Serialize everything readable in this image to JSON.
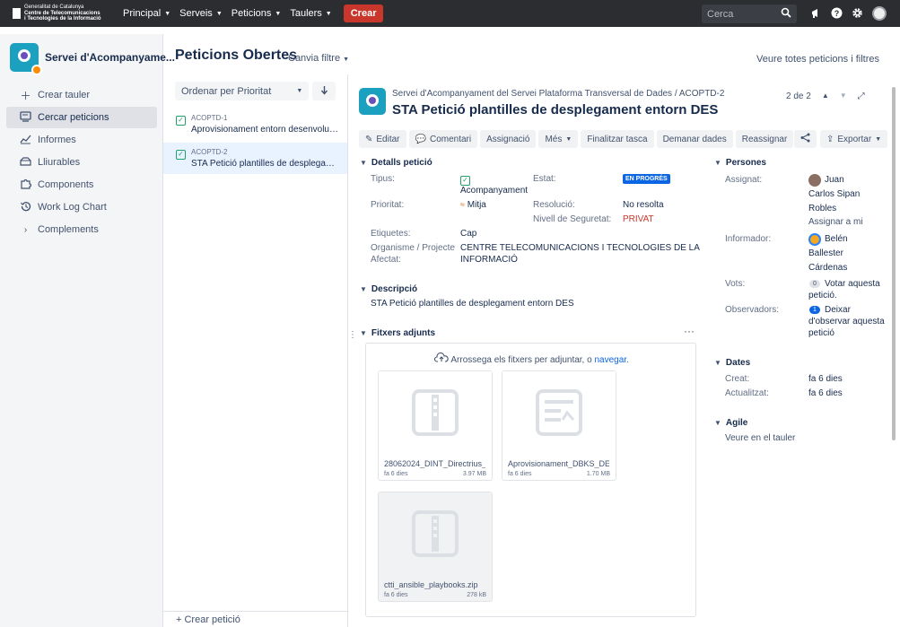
{
  "topbar": {
    "logo_lines": [
      "Generalitat de Catalunya",
      "Centre de Telecomunicacions",
      "i Tecnologies de la Informació"
    ],
    "nav": [
      "Principal",
      "Serveis",
      "Peticions",
      "Taulers"
    ],
    "create_label": "Crear",
    "search_placeholder": "Cerca",
    "icons": [
      "megaphone-icon",
      "help-icon",
      "settings-icon",
      "avatar"
    ]
  },
  "sidebar": {
    "project_name": "Servei d'Acompanyame...",
    "items": [
      {
        "label": "Crear tauler",
        "icon": "plus-icon"
      },
      {
        "label": "Cercar peticions",
        "icon": "search-board-icon",
        "active": true
      },
      {
        "label": "Informes",
        "icon": "chart-icon"
      },
      {
        "label": "Lliurables",
        "icon": "package-icon"
      },
      {
        "label": "Components",
        "icon": "puzzle-icon"
      },
      {
        "label": "Work Log Chart",
        "icon": "history-icon"
      },
      {
        "label": "Complements",
        "icon": "chevron-right-icon"
      }
    ]
  },
  "main": {
    "title": "Peticions Obertes",
    "change_filter": "Canvia filtre",
    "view_all": "Veure totes peticions i filtres"
  },
  "list": {
    "sort_label": "Ordenar per Prioritat",
    "items": [
      {
        "key": "ACOPTD-1",
        "summary": "Aprovisionament entorn desenvolupa...",
        "selected": false
      },
      {
        "key": "ACOPTD-2",
        "summary": "STA Petició plantilles de desplegament ...",
        "selected": true
      }
    ],
    "footer": "+ Crear petició"
  },
  "detail": {
    "breadcrumb_project": "Servei d'Acompanyament del Servei Plataforma Transversal de Dades",
    "breadcrumb_key": "ACOPTD-2",
    "title": "STA Petició plantilles de desplegament entorn DES",
    "pager": "2 de 2",
    "toolbar": [
      "Editar",
      "Comentari",
      "Assignació",
      "Més",
      "Finalitzar tasca",
      "Demanar dades",
      "Reassignar"
    ],
    "export_label": "Exportar",
    "details": {
      "section_title": "Detalls petició",
      "tipus_label": "Tipus:",
      "tipus_value": "Acompanyament",
      "estat_label": "Estat:",
      "estat_value": "EN PROGRÉS",
      "prioritat_label": "Prioritat:",
      "prioritat_value": "Mitja",
      "resolucio_label": "Resolució:",
      "resolucio_value": "No resolta",
      "nivell_label": "Nivell de Seguretat:",
      "nivell_value": "PRIVAT",
      "etiquetes_label": "Etiquetes:",
      "etiquetes_value": "Cap",
      "organisme_label_1": "Organisme / Projecte",
      "organisme_label_2": "Afectat:",
      "organisme_value_1": "CENTRE TELECOMUNICACIONS I TECNOLOGIES DE LA",
      "organisme_value_2": "INFORMACIÓ"
    },
    "description": {
      "section_title": "Descripció",
      "text": "STA Petició plantilles de desplegament entorn DES"
    },
    "attachments": {
      "section_title": "Fitxers adjunts",
      "drop_text": "Arrossega els fitxers per adjuntar, o",
      "drop_link": "navegar.",
      "files": [
        {
          "name": "28062024_DINT_Directrius_I...",
          "date": "fa 6 dies",
          "size": "3.97 MB",
          "icon": "zip-icon"
        },
        {
          "name": "Aprovisionament_DBKS_DEV...",
          "date": "fa 6 dies",
          "size": "1.70 MB",
          "icon": "document-icon"
        },
        {
          "name": "ctti_ansible_playbooks.zip",
          "date": "fa 6 dies",
          "size": "278 kB",
          "icon": "zip-icon"
        }
      ]
    },
    "people": {
      "section_title": "Persones",
      "assignat_label": "Assignat:",
      "assignat_lines": [
        "Juan",
        "Carlos Sipan",
        "Robles"
      ],
      "assign_to_me": "Assignar a mi",
      "informador_label": "Informador:",
      "informador_lines": [
        "Belén",
        "Ballester",
        "Cárdenas"
      ],
      "vots_label": "Vots:",
      "vots_count": "0",
      "vots_text_1": "Votar aquesta",
      "vots_text_2": "petició.",
      "observadors_label": "Observadors:",
      "observadors_count": "1",
      "observadors_text_1": "Deixar",
      "observadors_text_2": "d'observar aquesta",
      "observadors_text_3": "petició"
    },
    "dates": {
      "section_title": "Dates",
      "creat_label": "Creat:",
      "creat_value": "fa 6 dies",
      "actualitzat_label": "Actualitzat:",
      "actualitzat_value": "fa 6 dies"
    },
    "agile": {
      "section_title": "Agile",
      "link": "Veure en el tauler"
    }
  }
}
